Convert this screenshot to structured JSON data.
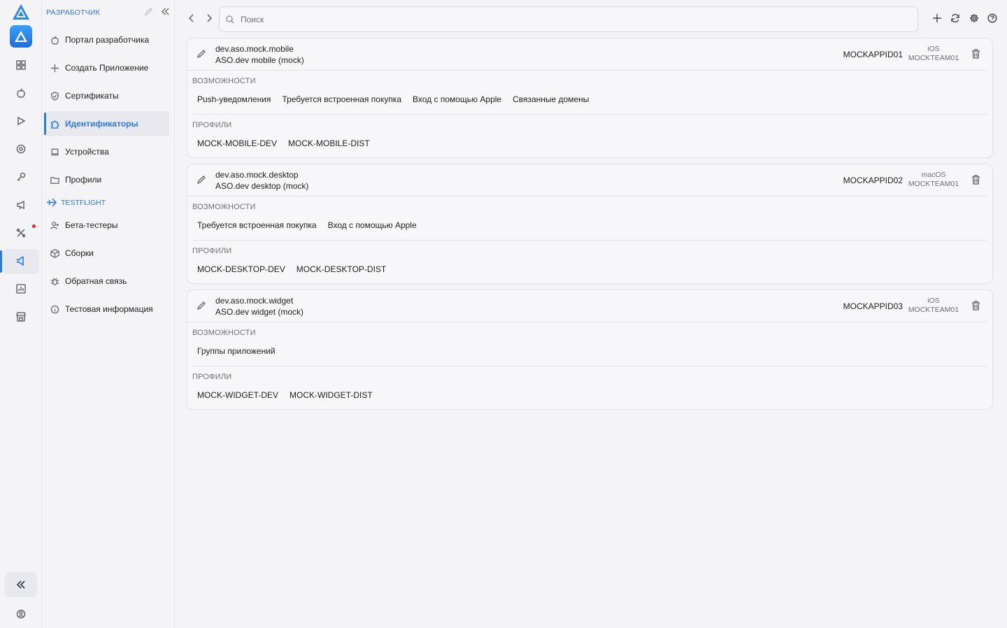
{
  "sidebar": {
    "title": "РАЗРАБОТЧИК",
    "items": [
      {
        "label": "Портал разработчика",
        "icon": "apple-icon"
      },
      {
        "label": "Создать Приложение",
        "icon": "plus-icon"
      },
      {
        "label": "Сертификаты",
        "icon": "shield-icon"
      },
      {
        "label": "Идентификаторы",
        "icon": "puzzle-icon",
        "active": true
      },
      {
        "label": "Устройства",
        "icon": "laptop-icon"
      },
      {
        "label": "Профили",
        "icon": "folder-icon"
      }
    ],
    "section": "TESTFLIGHT",
    "tf_items": [
      {
        "label": "Бета-тестеры",
        "icon": "user-plus-icon"
      },
      {
        "label": "Сборки",
        "icon": "box-icon"
      },
      {
        "label": "Обратная связь",
        "icon": "bug-icon"
      },
      {
        "label": "Тестовая информация",
        "icon": "info-icon"
      }
    ]
  },
  "search": {
    "placeholder": "Поиск"
  },
  "labels": {
    "capabilities": "ВОЗМОЖНОСТИ",
    "profiles": "ПРОФИЛИ"
  },
  "identifiers": [
    {
      "bundle_id": "dev.aso.mock.mobile",
      "name": "ASO.dev mobile (mock)",
      "app_id": "MOCKAPPID01",
      "platform": "iOS",
      "team": "MOCKTEAM01",
      "capabilities": [
        "Push-уведомления",
        "Требуется встроенная покупка",
        "Вход с помощью Apple",
        "Связанные домены"
      ],
      "profiles": [
        "MOCK-MOBILE-DEV",
        "MOCK-MOBILE-DIST"
      ]
    },
    {
      "bundle_id": "dev.aso.mock.desktop",
      "name": "ASO.dev desktop (mock)",
      "app_id": "MOCKAPPID02",
      "platform": "macOS",
      "team": "MOCKTEAM01",
      "capabilities": [
        "Требуется встроенная покупка",
        "Вход с помощью Apple"
      ],
      "profiles": [
        "MOCK-DESKTOP-DEV",
        "MOCK-DESKTOP-DIST"
      ]
    },
    {
      "bundle_id": "dev.aso.mock.widget",
      "name": "ASO.dev widget (mock)",
      "app_id": "MOCKAPPID03",
      "platform": "iOS",
      "team": "MOCKTEAM01",
      "capabilities": [
        "Группы приложений"
      ],
      "profiles": [
        "MOCK-WIDGET-DEV",
        "MOCK-WIDGET-DIST"
      ]
    }
  ],
  "colors": {
    "accent": "#2a7ae2",
    "alert": "#d62b2b"
  }
}
